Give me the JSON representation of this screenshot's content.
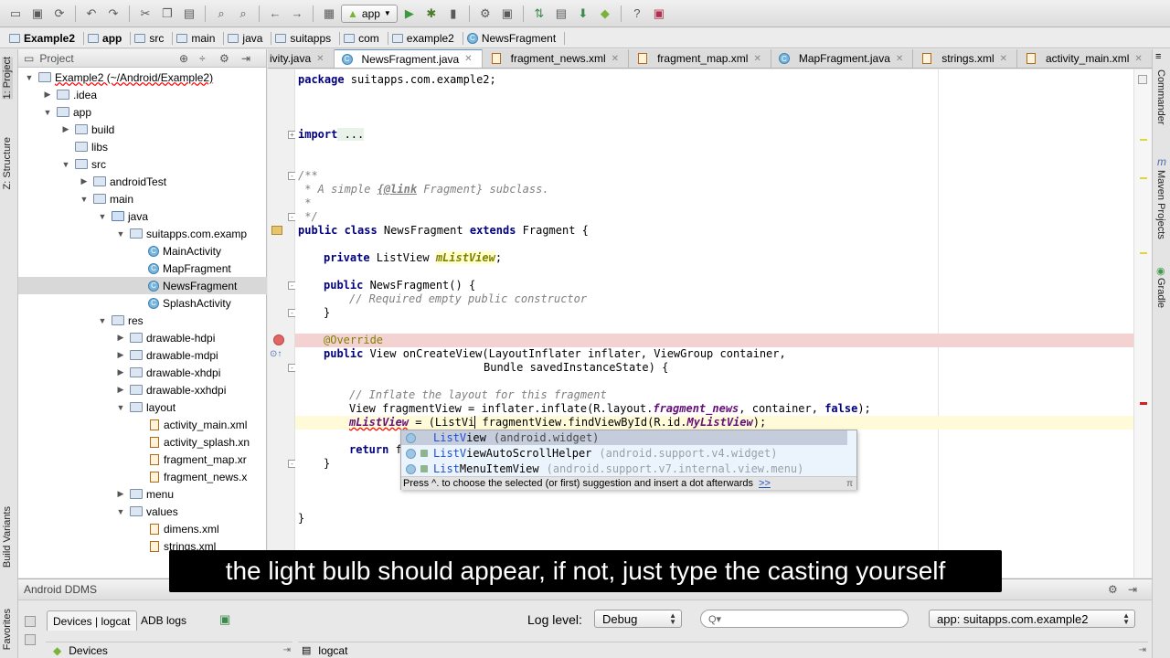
{
  "run_config": "app",
  "breadcrumbs": [
    "Example2",
    "app",
    "src",
    "main",
    "java",
    "suitapps",
    "com",
    "example2",
    "NewsFragment"
  ],
  "left_stripe": {
    "project_tab": "1: Project",
    "structure_tab": "Z: Structure",
    "build_variants_tab": "Build Variants",
    "favorites_tab": "Favorites"
  },
  "right_stripe": {
    "commander": "Commander",
    "maven": "Maven Projects",
    "gradle": "Gradle"
  },
  "project_panel": {
    "header": "Project",
    "items": [
      {
        "label": "Example2 (~/Android/Example2)"
      },
      {
        "label": ".idea"
      },
      {
        "label": "app"
      },
      {
        "label": "build"
      },
      {
        "label": "libs"
      },
      {
        "label": "src"
      },
      {
        "label": "androidTest"
      },
      {
        "label": "main"
      },
      {
        "label": "java"
      },
      {
        "label": "suitapps.com.examp"
      },
      {
        "label": "MainActivity"
      },
      {
        "label": "MapFragment"
      },
      {
        "label": "NewsFragment"
      },
      {
        "label": "SplashActivity"
      },
      {
        "label": "res"
      },
      {
        "label": "drawable-hdpi"
      },
      {
        "label": "drawable-mdpi"
      },
      {
        "label": "drawable-xhdpi"
      },
      {
        "label": "drawable-xxhdpi"
      },
      {
        "label": "layout"
      },
      {
        "label": "activity_main.xml"
      },
      {
        "label": "activity_splash.xn"
      },
      {
        "label": "fragment_map.xr"
      },
      {
        "label": "fragment_news.x"
      },
      {
        "label": "menu"
      },
      {
        "label": "values"
      },
      {
        "label": "dimens.xml"
      },
      {
        "label": "strings.xml"
      }
    ]
  },
  "editor_tabs": [
    "ivity.java",
    "NewsFragment.java",
    "fragment_news.xml",
    "fragment_map.xml",
    "MapFragment.java",
    "strings.xml",
    "activity_main.xml"
  ],
  "code": {
    "l1_kw": "package",
    "l1_rest": " suitapps.com.example2;",
    "l2_kw": "import",
    "l2_rest": " ...",
    "l3": "/**",
    "l4a": " * A simple ",
    "l4b": "{@link",
    "l4c": " Fragment}",
    "l4d": " subclass.",
    "l5": " *",
    "l6": " */",
    "l7_kw": "public class",
    "l7_name": " NewsFragment ",
    "l7_kw2": "extends",
    "l7_rest": " Fragment {",
    "l8_kw": "private",
    "l8_type": " ListView ",
    "l8_field": "mListView",
    "l8_end": ";",
    "l9_kw": "public",
    "l9_rest": " NewsFragment() {",
    "l10": "// Required empty public constructor",
    "l11": "}",
    "l12": "@Override",
    "l13_kw": "public",
    "l13_rest": " View onCreateView(LayoutInflater inflater, ViewGroup container,",
    "l14": "Bundle savedInstanceState) {",
    "l15": "// Inflate the layout for this fragment",
    "l16a": "View fragmentView = inflater.inflate(R.layout.",
    "l16b": "fragment_news",
    "l16c": ", container, ",
    "l16d": "false",
    "l16e": ");",
    "l17a": "mListView",
    "l17b": " = (ListVi",
    "l17c": " fragmentView.findViewById(R.id.",
    "l17d": "MyListView",
    "l17e": ");",
    "l18a": "return",
    "l18b": " f",
    "l19": "}",
    "l20": "}"
  },
  "completion": {
    "items": [
      {
        "prefix": "ListV",
        "rest": "iew",
        "pkg": "(android.widget)"
      },
      {
        "prefix": "ListV",
        "rest": "iewAutoScrollHelper",
        "pkg": "(android.support.v4.widget)"
      },
      {
        "prefix": "List",
        "rest": "MenuItemView",
        "pkg": "(android.support.v7.internal.view.menu)"
      }
    ],
    "hint": "Press ^. to choose the selected (or first) suggestion and insert a dot afterwards",
    "hint_link": ">>",
    "corner": "π"
  },
  "ddms": {
    "title": "Android DDMS",
    "tab_devices_logcat": "Devices | logcat",
    "tab_adb_logs": "ADB logs",
    "log_level_label": "Log level:",
    "log_level_value": "Debug",
    "search_placeholder": "Q▾",
    "app_filter": "app: suitapps.com.example2",
    "devices_label": "Devices",
    "logcat_label": "logcat"
  },
  "subtitle": "the light bulb should appear, if not, just type the casting yourself"
}
